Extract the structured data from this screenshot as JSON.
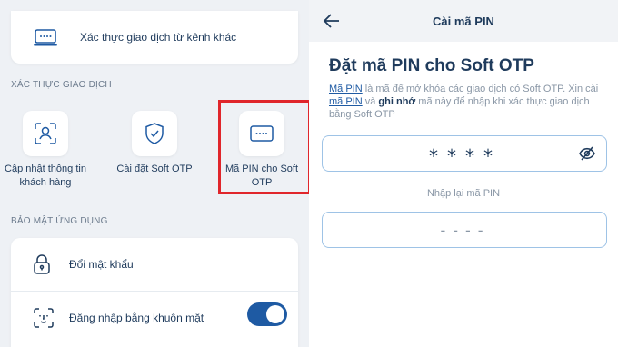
{
  "left": {
    "other_channel_label": "Xác thực giao dịch từ kênh khác",
    "section_transaction": "XÁC THỰC GIAO DỊCH",
    "tiles": [
      {
        "label": "Cập nhật thông tin khách hàng",
        "icon": "face-scan-icon"
      },
      {
        "label": "Cài đặt Soft OTP",
        "icon": "shield-check-icon"
      },
      {
        "label": "Mã PIN cho Soft OTP",
        "icon": "pin-dots-icon"
      }
    ],
    "section_security": "BẢO MẬT ỨNG DỤNG",
    "security_items": [
      {
        "label": "Đổi mật khẩu",
        "icon": "lock-icon"
      },
      {
        "label": "Đăng nhập bằng khuôn mặt",
        "icon": "face-id-icon",
        "toggle_on": true
      }
    ],
    "highlight_color": "#e0262b",
    "accent": "#1e5aa3"
  },
  "right": {
    "title": "Cài mã PIN",
    "heading": "Đặt mã PIN cho Soft OTP",
    "desc_link1": "Mã PIN",
    "desc_part1": " là mã để mở khóa các giao dịch có Soft OTP. Xin cài ",
    "desc_link2": "mã PIN",
    "desc_part2": " và ",
    "desc_bold": "ghi nhớ",
    "desc_part3": " mã này để nhập khi xác thực giao dịch bằng Soft OTP",
    "pin_value": "****",
    "confirm_label": "Nhập lại mã PIN",
    "confirm_placeholder": "----"
  }
}
